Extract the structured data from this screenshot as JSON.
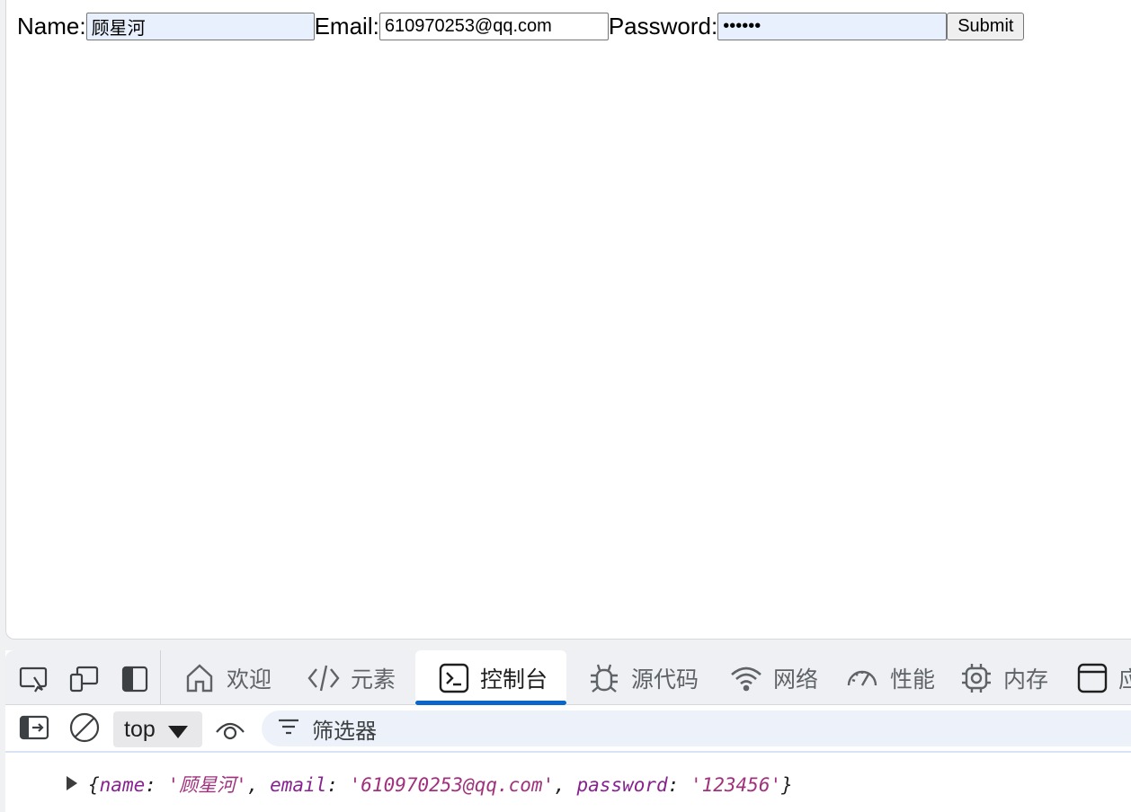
{
  "form": {
    "name_label": "Name:",
    "name_value": "顾星河",
    "email_label": "Email:",
    "email_value": "610970253@qq.com",
    "password_label": "Password:",
    "password_value": "123456",
    "submit_label": "Submit"
  },
  "devtools": {
    "tabs": [
      {
        "label": "欢迎",
        "icon": "home-icon"
      },
      {
        "label": "元素",
        "icon": "code-icon"
      },
      {
        "label": "控制台",
        "icon": "console-icon"
      },
      {
        "label": "源代码",
        "icon": "bug-icon"
      },
      {
        "label": "网络",
        "icon": "wifi-icon"
      },
      {
        "label": "性能",
        "icon": "gauge-icon"
      },
      {
        "label": "内存",
        "icon": "chip-icon"
      },
      {
        "label": "应",
        "icon": "application-icon"
      }
    ],
    "active_tab": "控制台",
    "context_select": "top",
    "filter_placeholder": "筛选器",
    "console": {
      "open_brace": "{",
      "close_brace": "}",
      "entries": [
        {
          "key": "name",
          "value": "'顾星河'"
        },
        {
          "key": "email",
          "value": "'610970253@qq.com'"
        },
        {
          "key": "password",
          "value": "'123456'"
        }
      ]
    },
    "colors": {
      "accent": "#0b66c9",
      "key": "#882290",
      "string": "#a0317c",
      "autofill": "#e8f0fe"
    }
  }
}
